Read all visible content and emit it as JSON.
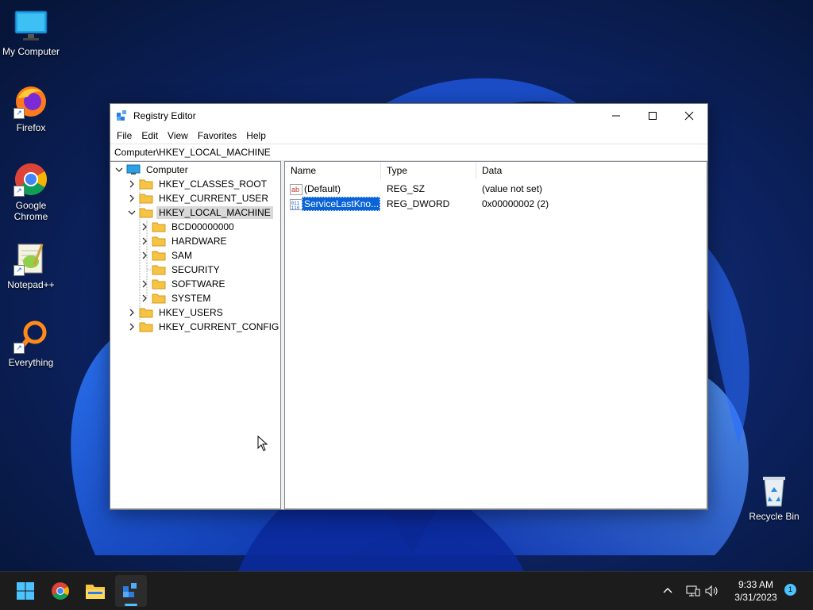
{
  "desktop": {
    "icons": [
      {
        "label": "My Computer",
        "icon": "monitor-icon"
      },
      {
        "label": "Firefox",
        "icon": "firefox-icon"
      },
      {
        "label": "Google Chrome",
        "icon": "chrome-icon"
      },
      {
        "label": "Notepad++",
        "icon": "notepadpp-icon"
      },
      {
        "label": "Everything",
        "icon": "search-magnifier-icon"
      },
      {
        "label": "Recycle Bin",
        "icon": "recycle-bin-icon"
      }
    ]
  },
  "window": {
    "title": "Registry Editor",
    "menu": [
      "File",
      "Edit",
      "View",
      "Favorites",
      "Help"
    ],
    "address": "Computer\\HKEY_LOCAL_MACHINE",
    "tree": {
      "root": "Computer",
      "hives": [
        {
          "label": "HKEY_CLASSES_ROOT"
        },
        {
          "label": "HKEY_CURRENT_USER"
        },
        {
          "label": "HKEY_LOCAL_MACHINE",
          "selected": true,
          "expanded": true,
          "children": [
            "BCD00000000",
            "HARDWARE",
            "SAM",
            "SECURITY",
            "SOFTWARE",
            "SYSTEM"
          ]
        },
        {
          "label": "HKEY_USERS"
        },
        {
          "label": "HKEY_CURRENT_CONFIG"
        }
      ]
    },
    "columns": {
      "name": "Name",
      "type": "Type",
      "data": "Data"
    },
    "values": [
      {
        "name": "(Default)",
        "type": "REG_SZ",
        "data": "(value not set)",
        "icon": "string-value-icon"
      },
      {
        "name": "ServiceLastKno...",
        "type": "REG_DWORD",
        "data": "0x00000002 (2)",
        "icon": "binary-value-icon",
        "selected": true
      }
    ]
  },
  "taskbar": {
    "apps": [
      "start-icon",
      "chrome-icon",
      "file-explorer-icon",
      "registry-editor-icon"
    ],
    "time": "9:33 AM",
    "date": "3/31/2023",
    "notifications": "1"
  },
  "colors": {
    "selection": "#0a64d8",
    "taskbar": "#1c1c1c",
    "accent": "#4cc2ff"
  }
}
